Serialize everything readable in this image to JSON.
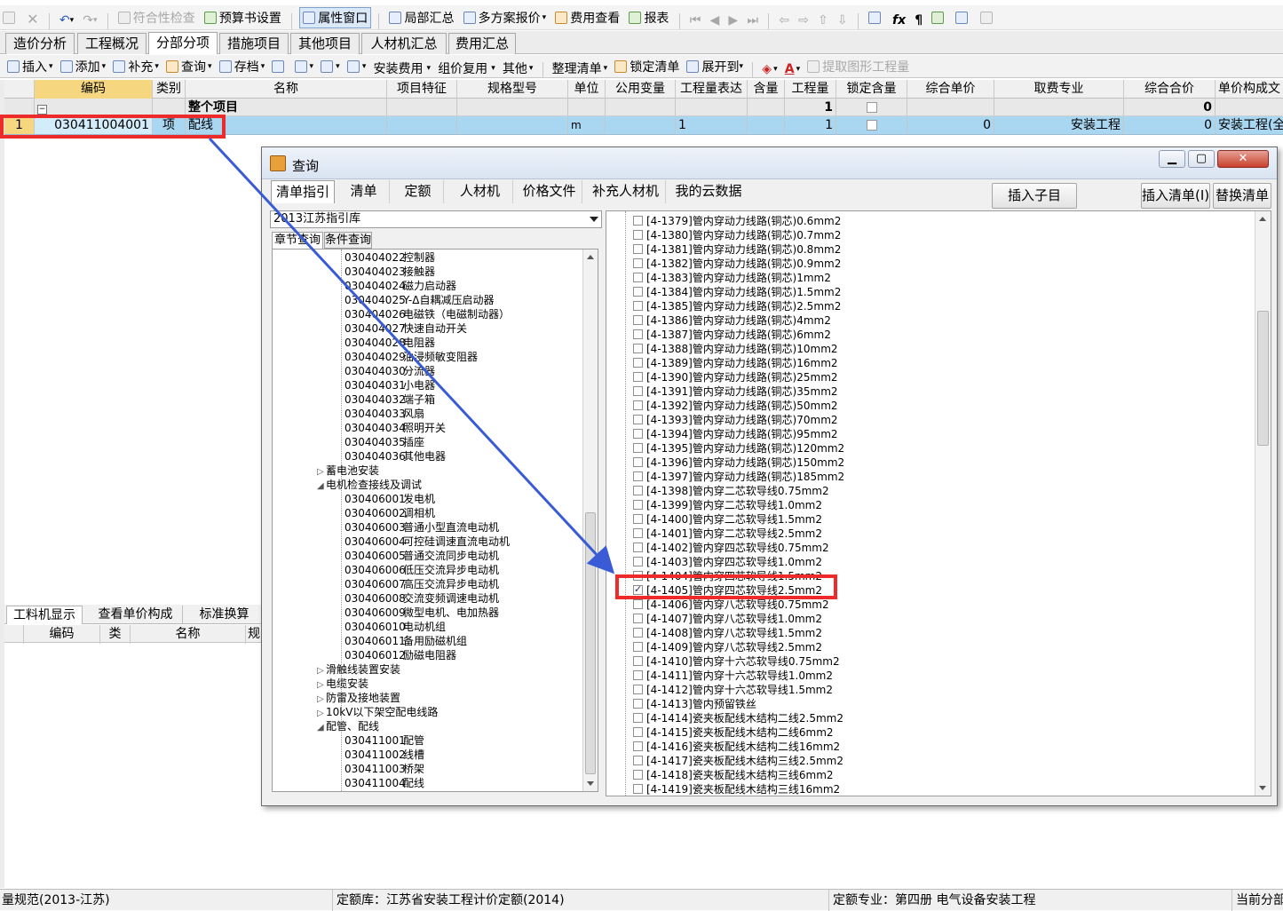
{
  "toolbar1": {
    "compliance_check": "符合性检查",
    "budget_settings": "预算书设置",
    "property_window": "属性窗口",
    "local_summary": "局部汇总",
    "multi_quote": "多方案报价",
    "fee_view": "费用查看",
    "report": "报表"
  },
  "tabs": [
    "造价分析",
    "工程概况",
    "分部分项",
    "措施项目",
    "其他项目",
    "人材机汇总",
    "费用汇总"
  ],
  "toolbar2": {
    "insert": "插入",
    "add": "添加",
    "supplement": "补充",
    "query": "查询",
    "archive": "存档",
    "install_fee": "安装费用",
    "price_reuse": "组价复用",
    "other": "其他",
    "organize_list": "整理清单",
    "lock_list": "锁定清单",
    "expand_to": "展开到",
    "extract_quantity": "提取图形工程量"
  },
  "grid": {
    "headers": [
      "编码",
      "类别",
      "名称",
      "项目特征",
      "规格型号",
      "单位",
      "公用变量",
      "工程量表达",
      "含量",
      "工程量",
      "锁定含量",
      "综合单价",
      "取费专业",
      "综合合价",
      "单价构成文"
    ],
    "whole_project": {
      "toggle": "−",
      "name": "整个项目",
      "quantity": "1",
      "total": "0"
    },
    "row1": {
      "index": "1",
      "code": "030411004001",
      "category": "项",
      "name": "配线",
      "unit": "m",
      "quantity_expr": "1",
      "quantity": "1",
      "unit_price": "0",
      "fee_specialty": "安装工程",
      "total_price": "0",
      "price_composition": "安装工程(全"
    }
  },
  "lower_panel": {
    "tabs": [
      "工料机显示",
      "查看单价构成",
      "标准换算"
    ],
    "headers": [
      "编码",
      "类",
      "名称",
      "规"
    ]
  },
  "dialog": {
    "title": "查询",
    "tabs": [
      "清单指引",
      "清单",
      "定额",
      "人材机",
      "价格文件",
      "补充人材机",
      "我的云数据"
    ],
    "buttons": {
      "insert_child": "插入子目",
      "insert_list": "插入清单(I)",
      "replace_list": "替换清单"
    },
    "library": "2013江苏指引库",
    "subtabs": [
      "章节查询",
      "条件查询"
    ],
    "tree": [
      {
        "code": "030404022",
        "name": "控制器"
      },
      {
        "code": "030404023",
        "name": "接触器"
      },
      {
        "code": "030404024",
        "name": "磁力启动器"
      },
      {
        "code": "030404025",
        "name": "Y-Δ自耦减压启动器"
      },
      {
        "code": "030404026",
        "name": "电磁铁（电磁制动器）"
      },
      {
        "code": "030404027",
        "name": "快速自动开关"
      },
      {
        "code": "030404028",
        "name": "电阻器"
      },
      {
        "code": "030404029",
        "name": "油浸频敏变阻器"
      },
      {
        "code": "030404030",
        "name": "分流器"
      },
      {
        "code": "030404031",
        "name": "小电器"
      },
      {
        "code": "030404032",
        "name": "端子箱"
      },
      {
        "code": "030404033",
        "name": "风扇"
      },
      {
        "code": "030404034",
        "name": "照明开关"
      },
      {
        "code": "030404035",
        "name": "插座"
      },
      {
        "code": "030404036",
        "name": "其他电器"
      },
      {
        "folder": "蓄电池安装",
        "expanded": false
      },
      {
        "folder": "电机检查接线及调试",
        "expanded": true
      },
      {
        "code": "030406001",
        "name": "发电机"
      },
      {
        "code": "030406002",
        "name": "调相机"
      },
      {
        "code": "030406003",
        "name": "普通小型直流电动机"
      },
      {
        "code": "030406004",
        "name": "可控硅调速直流电动机"
      },
      {
        "code": "030406005",
        "name": "普通交流同步电动机"
      },
      {
        "code": "030406006",
        "name": "低压交流异步电动机"
      },
      {
        "code": "030406007",
        "name": "高压交流异步电动机"
      },
      {
        "code": "030406008",
        "name": "交流变频调速电动机"
      },
      {
        "code": "030406009",
        "name": "微型电机、电加热器"
      },
      {
        "code": "030406010",
        "name": "电动机组"
      },
      {
        "code": "030406011",
        "name": "备用励磁机组"
      },
      {
        "code": "030406012",
        "name": "励磁电阻器"
      },
      {
        "folder": "滑触线装置安装",
        "expanded": false
      },
      {
        "folder": "电缆安装",
        "expanded": false
      },
      {
        "folder": "防雷及接地装置",
        "expanded": false
      },
      {
        "folder": "10kV以下架空配电线路",
        "expanded": false
      },
      {
        "folder": "配管、配线",
        "expanded": true
      },
      {
        "code": "030411001",
        "name": "配管"
      },
      {
        "code": "030411002",
        "name": "线槽"
      },
      {
        "code": "030411003",
        "name": "桥架"
      },
      {
        "code": "030411004",
        "name": "配线"
      }
    ],
    "list": [
      {
        "text": "[4-1379]管内穿动力线路(铜芯)0.6mm2",
        "checked": false
      },
      {
        "text": "[4-1380]管内穿动力线路(铜芯)0.7mm2",
        "checked": false
      },
      {
        "text": "[4-1381]管内穿动力线路(铜芯)0.8mm2",
        "checked": false
      },
      {
        "text": "[4-1382]管内穿动力线路(铜芯)0.9mm2",
        "checked": false
      },
      {
        "text": "[4-1383]管内穿动力线路(铜芯)1mm2",
        "checked": false
      },
      {
        "text": "[4-1384]管内穿动力线路(铜芯)1.5mm2",
        "checked": false
      },
      {
        "text": "[4-1385]管内穿动力线路(铜芯)2.5mm2",
        "checked": false
      },
      {
        "text": "[4-1386]管内穿动力线路(铜芯)4mm2",
        "checked": false
      },
      {
        "text": "[4-1387]管内穿动力线路(铜芯)6mm2",
        "checked": false
      },
      {
        "text": "[4-1388]管内穿动力线路(铜芯)10mm2",
        "checked": false
      },
      {
        "text": "[4-1389]管内穿动力线路(铜芯)16mm2",
        "checked": false
      },
      {
        "text": "[4-1390]管内穿动力线路(铜芯)25mm2",
        "checked": false
      },
      {
        "text": "[4-1391]管内穿动力线路(铜芯)35mm2",
        "checked": false
      },
      {
        "text": "[4-1392]管内穿动力线路(铜芯)50mm2",
        "checked": false
      },
      {
        "text": "[4-1393]管内穿动力线路(铜芯)70mm2",
        "checked": false
      },
      {
        "text": "[4-1394]管内穿动力线路(铜芯)95mm2",
        "checked": false
      },
      {
        "text": "[4-1395]管内穿动力线路(铜芯)120mm2",
        "checked": false
      },
      {
        "text": "[4-1396]管内穿动力线路(铜芯)150mm2",
        "checked": false
      },
      {
        "text": "[4-1397]管内穿动力线路(铜芯)185mm2",
        "checked": false
      },
      {
        "text": "[4-1398]管内穿二芯软导线0.75mm2",
        "checked": false
      },
      {
        "text": "[4-1399]管内穿二芯软导线1.0mm2",
        "checked": false
      },
      {
        "text": "[4-1400]管内穿二芯软导线1.5mm2",
        "checked": false
      },
      {
        "text": "[4-1401]管内穿二芯软导线2.5mm2",
        "checked": false
      },
      {
        "text": "[4-1402]管内穿四芯软导线0.75mm2",
        "checked": false
      },
      {
        "text": "[4-1403]管内穿四芯软导线1.0mm2",
        "checked": false
      },
      {
        "text": "[4-1404]管内穿四芯软导线1.5mm2",
        "checked": false
      },
      {
        "text": "[4-1405]管内穿四芯软导线2.5mm2",
        "checked": true
      },
      {
        "text": "[4-1406]管内穿八芯软导线0.75mm2",
        "checked": false
      },
      {
        "text": "[4-1407]管内穿八芯软导线1.0mm2",
        "checked": false
      },
      {
        "text": "[4-1408]管内穿八芯软导线1.5mm2",
        "checked": false
      },
      {
        "text": "[4-1409]管内穿八芯软导线2.5mm2",
        "checked": false
      },
      {
        "text": "[4-1410]管内穿十六芯软导线0.75mm2",
        "checked": false
      },
      {
        "text": "[4-1411]管内穿十六芯软导线1.0mm2",
        "checked": false
      },
      {
        "text": "[4-1412]管内穿十六芯软导线1.5mm2",
        "checked": false
      },
      {
        "text": "[4-1413]管内预留铁丝",
        "checked": false
      },
      {
        "text": "[4-1414]瓷夹板配线木结构二线2.5mm2",
        "checked": false
      },
      {
        "text": "[4-1415]瓷夹板配线木结构二线6mm2",
        "checked": false
      },
      {
        "text": "[4-1416]瓷夹板配线木结构二线16mm2",
        "checked": false
      },
      {
        "text": "[4-1417]瓷夹板配线木结构三线2.5mm2",
        "checked": false
      },
      {
        "text": "[4-1418]瓷夹板配线木结构三线6mm2",
        "checked": false
      },
      {
        "text": "[4-1419]瓷夹板配线木结构三线16mm2",
        "checked": false
      }
    ]
  },
  "status": {
    "spec": "量规范(2013-江苏)",
    "quota_lib": "定额库：江苏省安装工程计价定额(2014)",
    "quota_major": "定额专业：第四册 电气设备安装工程",
    "current": "当前分部"
  },
  "annotation": {
    "highlight_color": "#ee2b2b",
    "arrow_color": "#3a5bd6"
  }
}
